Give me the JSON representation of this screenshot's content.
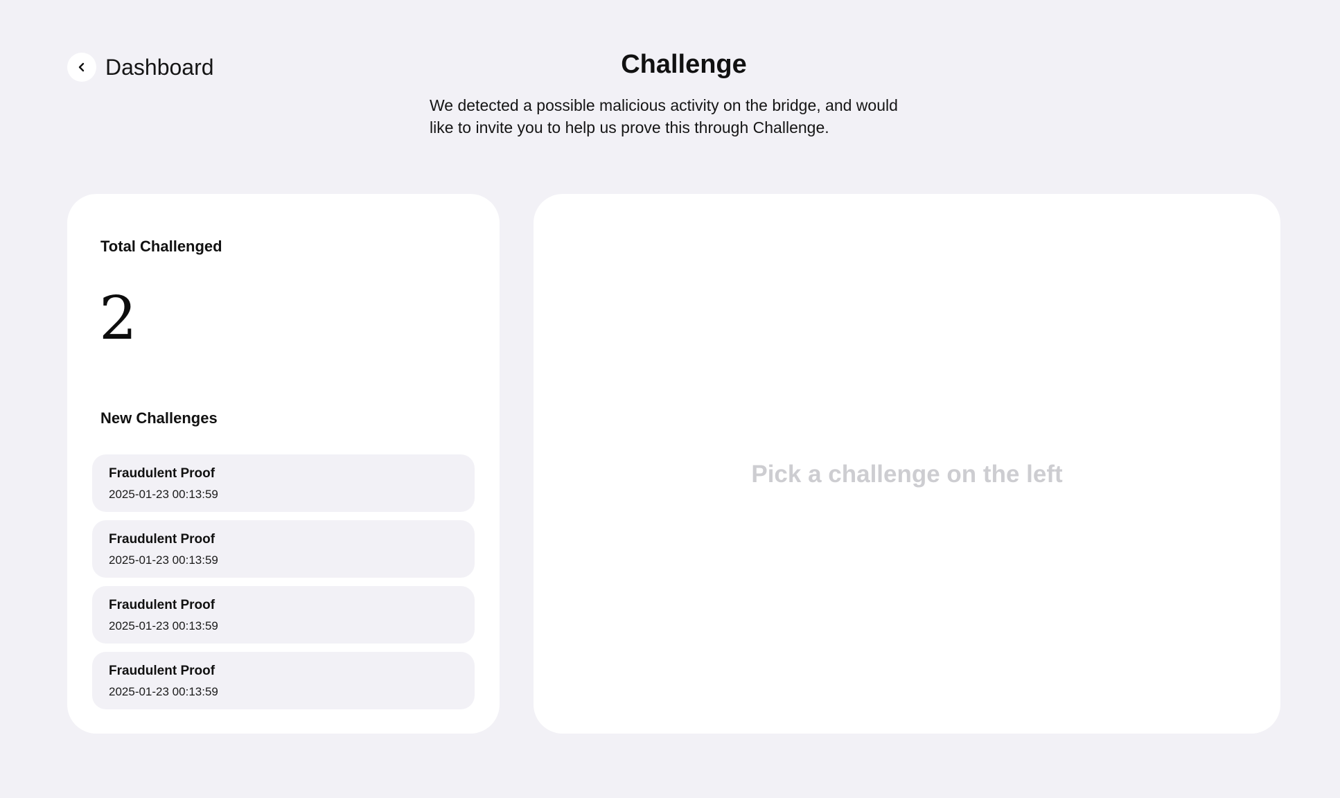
{
  "header": {
    "back_label": "Dashboard",
    "title": "Challenge",
    "description": "We detected a possible malicious activity on the bridge, and would like to invite you to help us prove this through Challenge."
  },
  "summary": {
    "total_label": "Total Challenged",
    "total_value": "2",
    "list_heading": "New Challenges"
  },
  "challenges": [
    {
      "title": "Fraudulent Proof",
      "time": "2025-01-23 00:13:59"
    },
    {
      "title": "Fraudulent Proof",
      "time": "2025-01-23 00:13:59"
    },
    {
      "title": "Fraudulent Proof",
      "time": "2025-01-23 00:13:59"
    },
    {
      "title": "Fraudulent Proof",
      "time": "2025-01-23 00:13:59"
    }
  ],
  "detail": {
    "placeholder": "Pick a challenge on the left"
  },
  "icons": {
    "back": "chevron-left-icon"
  }
}
